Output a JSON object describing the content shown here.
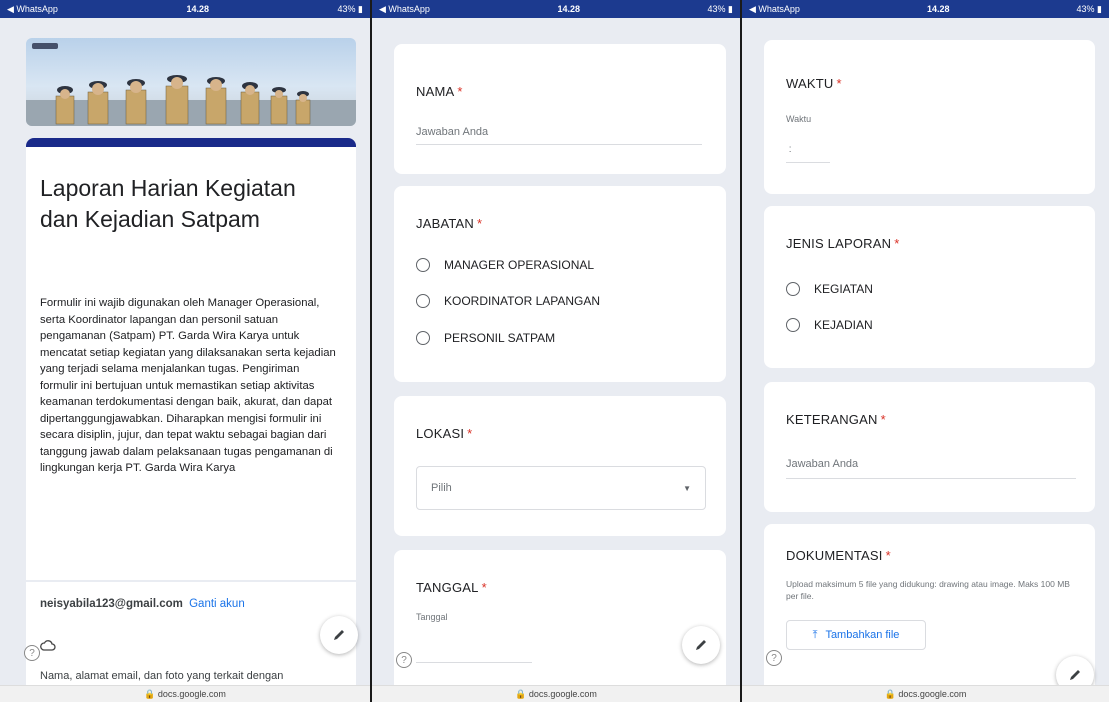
{
  "status": {
    "left": "◀ WhatsApp",
    "time": "14.28",
    "battery": "43%"
  },
  "url": "docs.google.com",
  "form": {
    "title": "Laporan Harian Kegiatan dan Kejadian Satpam",
    "description": "Formulir ini wajib digunakan oleh Manager Operasional, serta Koordinator lapangan dan personil satuan pengamanan (Satpam) PT. Garda Wira Karya untuk mencatat setiap kegiatan yang dilaksanakan serta kejadian yang terjadi selama menjalankan tugas. Pengiriman formulir ini bertujuan untuk memastikan setiap aktivitas keamanan terdokumentasi dengan baik, akurat, dan dapat dipertanggungjawabkan. Diharapkan mengisi formulir ini secara disiplin, jujur, dan tepat waktu sebagai bagian dari tanggung jawab dalam pelaksanaan tugas pengamanan di lingkungan kerja PT. Garda Wira Karya",
    "email": "neisyabila123@gmail.com",
    "switch_account": "Ganti akun",
    "privacy_note": "Nama, alamat email, dan foto yang terkait dengan"
  },
  "questions": {
    "nama": {
      "label": "NAMA",
      "placeholder": "Jawaban Anda"
    },
    "jabatan": {
      "label": "JABATAN",
      "options": [
        "MANAGER OPERASIONAL",
        "KOORDINATOR LAPANGAN",
        "PERSONIL SATPAM"
      ]
    },
    "lokasi": {
      "label": "LOKASI",
      "placeholder": "Pilih"
    },
    "tanggal": {
      "label": "TANGGAL",
      "sub": "Tanggal"
    },
    "waktu": {
      "label": "WAKTU",
      "sub": "Waktu"
    },
    "jenis": {
      "label": "JENIS LAPORAN",
      "options": [
        "KEGIATAN",
        "KEJADIAN"
      ]
    },
    "keterangan": {
      "label": "KETERANGAN",
      "placeholder": "Jawaban Anda"
    },
    "dokumentasi": {
      "label": "DOKUMENTASI",
      "note": "Upload maksimum 5 file yang didukung: drawing atau image. Maks 100 MB per file.",
      "button": "Tambahkan file"
    }
  },
  "required_mark": "*"
}
